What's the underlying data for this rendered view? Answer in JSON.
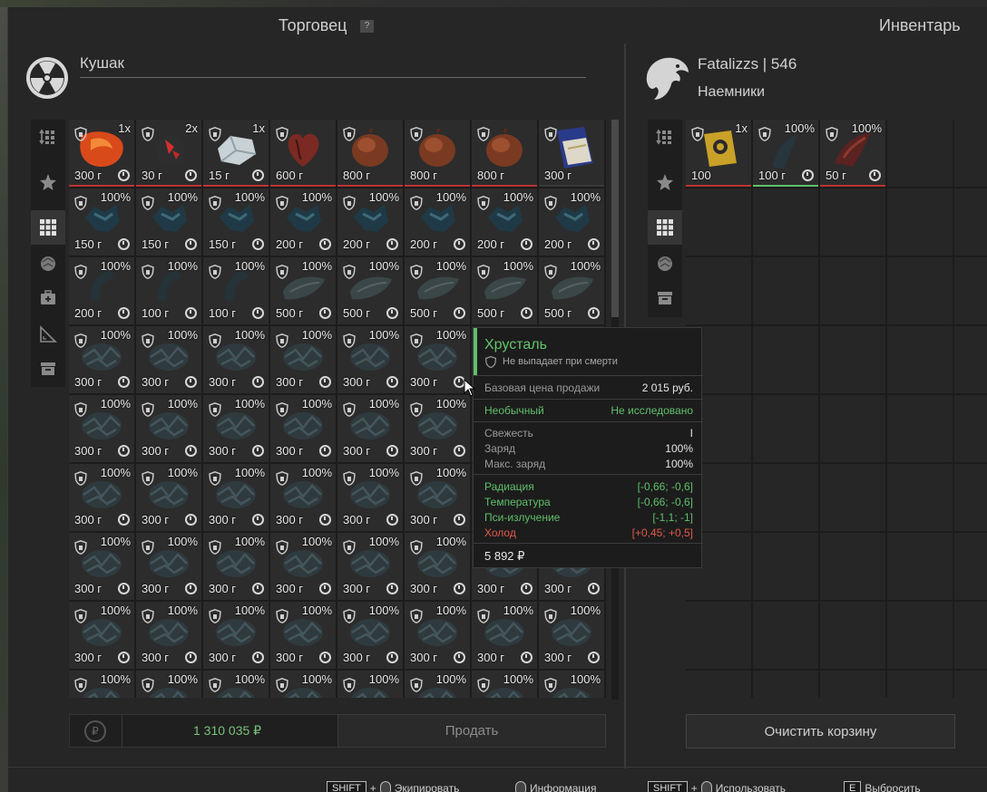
{
  "header": {
    "trader_title": "Торговец",
    "help": "?",
    "inventory_title": "Инвентарь"
  },
  "trader": {
    "name": "Кушак"
  },
  "player": {
    "name": "Fatalizzs | 546",
    "group": "Наемники"
  },
  "icons": {
    "trader_logo": "radiation-icon",
    "player_logo": "eagle-icon",
    "sort": "sort-icon",
    "favorites": "star-icon",
    "all": "grid-icon",
    "artifacts": "artifact-icon",
    "medicine": "medkit-icon",
    "tools": "ruler-icon",
    "storage": "crate-icon",
    "currency": "ruble-cycle-icon"
  },
  "trader_grid": {
    "row1": [
      {
        "tag": "1x",
        "price": "300 г",
        "kind": "amber",
        "line": "#b33"
      },
      {
        "tag": "2x",
        "price": "30 г",
        "kind": "ore",
        "line": "#b33"
      },
      {
        "tag": "1x",
        "price": "15 г",
        "kind": "crystal",
        "line": "#b33"
      },
      {
        "tag": "",
        "price": "600 г",
        "kind": "heart",
        "line": "#b33"
      },
      {
        "tag": "",
        "price": "800 г",
        "kind": "flesh",
        "line": "#b33"
      },
      {
        "tag": "",
        "price": "800 г",
        "kind": "flesh",
        "line": "#b33"
      },
      {
        "tag": "",
        "price": "800 г",
        "kind": "flesh",
        "line": "#b33"
      },
      {
        "tag": "",
        "price": "300 г",
        "kind": "book",
        "line": "#3a3a3a"
      }
    ],
    "row2": [
      {
        "tag": "100%",
        "price": "150 г"
      },
      {
        "tag": "100%",
        "price": "150 г"
      },
      {
        "tag": "100%",
        "price": "150 г"
      },
      {
        "tag": "100%",
        "price": "200 г"
      },
      {
        "tag": "100%",
        "price": "200 г"
      },
      {
        "tag": "100%",
        "price": "200 г"
      },
      {
        "tag": "100%",
        "price": "200 г"
      },
      {
        "tag": "100%",
        "price": "200 г"
      }
    ],
    "row3": [
      {
        "tag": "100%",
        "price": "200 г"
      },
      {
        "tag": "100%",
        "price": "100 г"
      },
      {
        "tag": "100%",
        "price": "100 г"
      },
      {
        "tag": "100%",
        "price": "500 г"
      },
      {
        "tag": "100%",
        "price": "500 г"
      },
      {
        "tag": "100%",
        "price": "500 г"
      },
      {
        "tag": "100%",
        "price": "500 г"
      },
      {
        "tag": "100%",
        "price": "500 г"
      }
    ],
    "filler_tag": "100%",
    "filler_price": "300 г"
  },
  "inventory_grid": [
    {
      "tag": "1x",
      "price": "100",
      "kind": "camera",
      "line": "#b33"
    },
    {
      "tag": "100%",
      "price": "100 г",
      "kind": "claw",
      "line": "#5fc06a"
    },
    {
      "tag": "100%",
      "price": "50 г",
      "kind": "claw-red",
      "line": "#b33"
    }
  ],
  "tooltip": {
    "title": "Хрусталь",
    "subtitle": "Не выпадает при смерти",
    "base_price_label": "Базовая цена продажи",
    "base_price_value": "2 015 руб.",
    "rarity": "Необычный",
    "research": "Не исследовано",
    "freshness_label": "Свежесть",
    "freshness_value": "I",
    "charge_label": "Заряд",
    "charge_value": "100%",
    "max_charge_label": "Макс. заряд",
    "max_charge_value": "100%",
    "radiation_label": "Радиация",
    "radiation_value": "[-0,66; -0,6]",
    "temperature_label": "Температура",
    "temperature_value": "[-0,66; -0,6]",
    "psy_label": "Пси-излучение",
    "psy_value": "[-1,1; -1]",
    "cold_label": "Холод",
    "cold_value": "[+0,45; +0,5]",
    "total": "5 892 ₽"
  },
  "footer": {
    "money": "1 310 035 ₽",
    "sell": "Продать",
    "clear_cart": "Очистить корзину"
  },
  "hints": [
    {
      "key": "SHIFT",
      "plus": "+",
      "label": "Экипировать"
    },
    {
      "key": "",
      "plus": "",
      "label": "Информация"
    },
    {
      "key": "SHIFT",
      "plus": "+",
      "label": "Использовать"
    },
    {
      "key": "E",
      "plus": "",
      "label": "Выбросить"
    }
  ]
}
